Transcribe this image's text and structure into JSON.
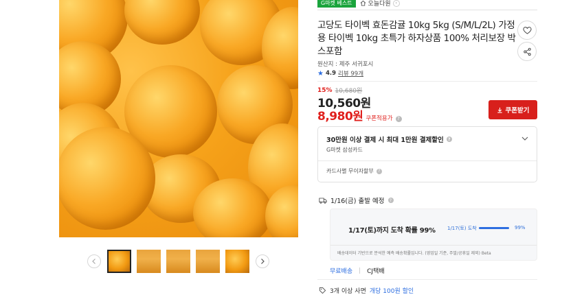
{
  "badges": {
    "gmarket_best": "G마켓 베스트",
    "today_delivery": "오늘다원"
  },
  "product": {
    "title": "고당도 타이벡 효돈감귤 10kg 5kg (S/M/L/2L) 가정용 타이벡 10kg 초특가 하자상품 100% 처리보장 박스포함",
    "origin": "원산지 : 제주 서귀포시",
    "rating": "4.9",
    "review_label": "리뷰 99개",
    "discount_pct": "15%",
    "original_price": "10,680원",
    "price": "10,560원",
    "coupon_price": "8,980원",
    "coupon_price_label": "쿠폰적용가",
    "coupon_button": "쿠폰받기"
  },
  "card_promo": {
    "title": "30만원 이상 결제 시 최대 1만원 결제할인",
    "card": "G마켓 삼성카드",
    "installment": "카드사별 무이자할부"
  },
  "shipping": {
    "depart": "1/16(금) 출발 예정",
    "arrival_text": "1/17(토)까지 도착 확률 99%",
    "arrival_mini": "1/17(토) 도착",
    "arrival_probability": 99,
    "arrival_pct_label": "99%",
    "note": "배송데이터 기반으로 분석한 예측 배송확률입니다. (영업일 기준, 주말/공휴일 제외) Beta",
    "free": "무료배송",
    "carrier": "CJ택배"
  },
  "promo": {
    "prefix": "3개 이상 사면",
    "highlight": "개당 100원 할인"
  },
  "icons": {
    "wishlist": "heart-icon",
    "share": "share-icon",
    "prev": "chevron-left-icon",
    "next": "chevron-right-icon",
    "truck": "truck-icon",
    "tag": "tag-icon",
    "expand": "chevron-down-icon",
    "coupon_download": "download-icon"
  },
  "colors": {
    "accent_red": "#d8201c",
    "accent_blue": "#2d6ee0",
    "badge_green": "#1aa43c"
  }
}
